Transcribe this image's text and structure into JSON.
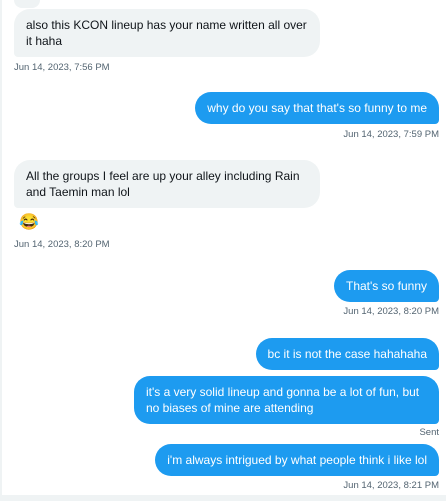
{
  "messages": [
    {
      "text": "also this KCON lineup has your name written all over it haha",
      "time": "Jun 14, 2023, 7:56 PM"
    },
    {
      "text": "why do you say that that's so funny to me",
      "time": "Jun 14, 2023, 7:59 PM"
    },
    {
      "text": "All the groups I feel are up your alley including Rain and Taemin man lol",
      "reaction": "😂",
      "time": "Jun 14, 2023, 8:20 PM"
    },
    {
      "text": "That's so funny",
      "time": "Jun 14, 2023, 8:20 PM"
    },
    {
      "text": "bc it is not the case hahahaha"
    },
    {
      "text": "it's a very solid lineup and gonna be a lot of fun, but no biases of mine are attending",
      "status": "Sent"
    },
    {
      "text": "i'm always intrigued by what people think i like lol",
      "time": "Jun 14, 2023, 8:21 PM"
    }
  ]
}
